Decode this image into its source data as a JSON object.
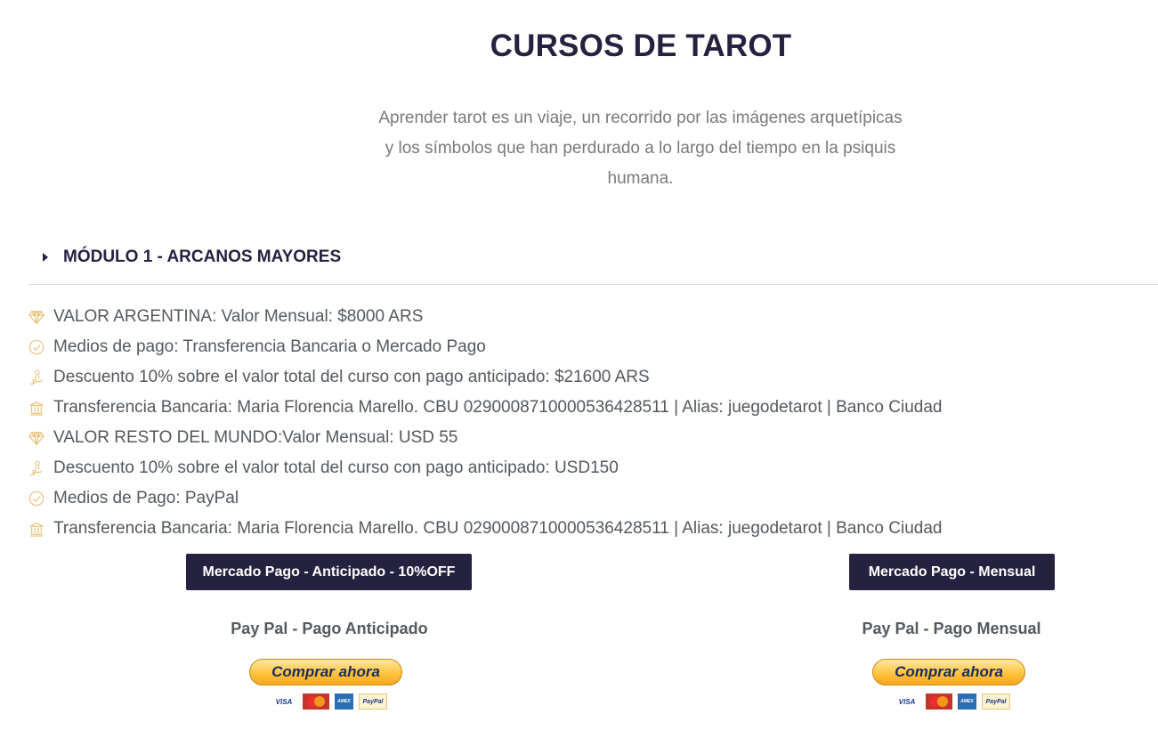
{
  "page_title": "CURSOS DE TAROT",
  "intro_text": "Aprender tarot es un viaje, un recorrido por las imágenes arquetípicas y los símbolos que han perdurado a lo largo del tiempo en la psiquis humana.",
  "accordion": {
    "title": "MÓDULO 1 - ARCANOS MAYORES",
    "items": [
      {
        "icon": "diamond-icon",
        "text": "VALOR ARGENTINA: Valor Mensual: $8000 ARS"
      },
      {
        "icon": "check-circle-icon",
        "text": "Medios de pago: Transferencia Bancaria o Mercado Pago"
      },
      {
        "icon": "hand-coins-icon",
        "text": "Descuento 10% sobre el valor total del curso con pago anticipado: $21600 ARS"
      },
      {
        "icon": "bank-icon",
        "text": "Transferencia Bancaria: Maria Florencia Marello. CBU 0290008710000536428511 | Alias: juegodetarot | Banco Ciudad"
      },
      {
        "icon": "diamond-icon",
        "text": "VALOR RESTO DEL MUNDO:Valor Mensual: USD 55"
      },
      {
        "icon": "hand-coins-icon",
        "text": "Descuento 10% sobre el valor total del curso con pago anticipado: USD150"
      },
      {
        "icon": "check-circle-icon",
        "text": "Medios de Pago: PayPal"
      },
      {
        "icon": "bank-icon",
        "text": "Transferencia Bancaria: Maria Florencia Marello. CBU 0290008710000536428511 | Alias: juegodetarot | Banco Ciudad"
      }
    ]
  },
  "buttons": {
    "mp_anticipado": "Mercado Pago - Anticipado - 10%OFF",
    "mp_mensual": "Mercado Pago - Mensual"
  },
  "paypal": {
    "anticipado_label": "Pay Pal - Pago Anticipado",
    "mensual_label": "Pay Pal - Pago Mensual",
    "buy_button": "Comprar ahora",
    "cards": [
      "VISA",
      "MasterCard",
      "AMEX",
      "PayPal"
    ]
  },
  "colors": {
    "dark_navy": "#25223f",
    "icon_gold": "#e8c27a",
    "body_text": "#54595f",
    "intro_text": "#7a7a7a"
  }
}
